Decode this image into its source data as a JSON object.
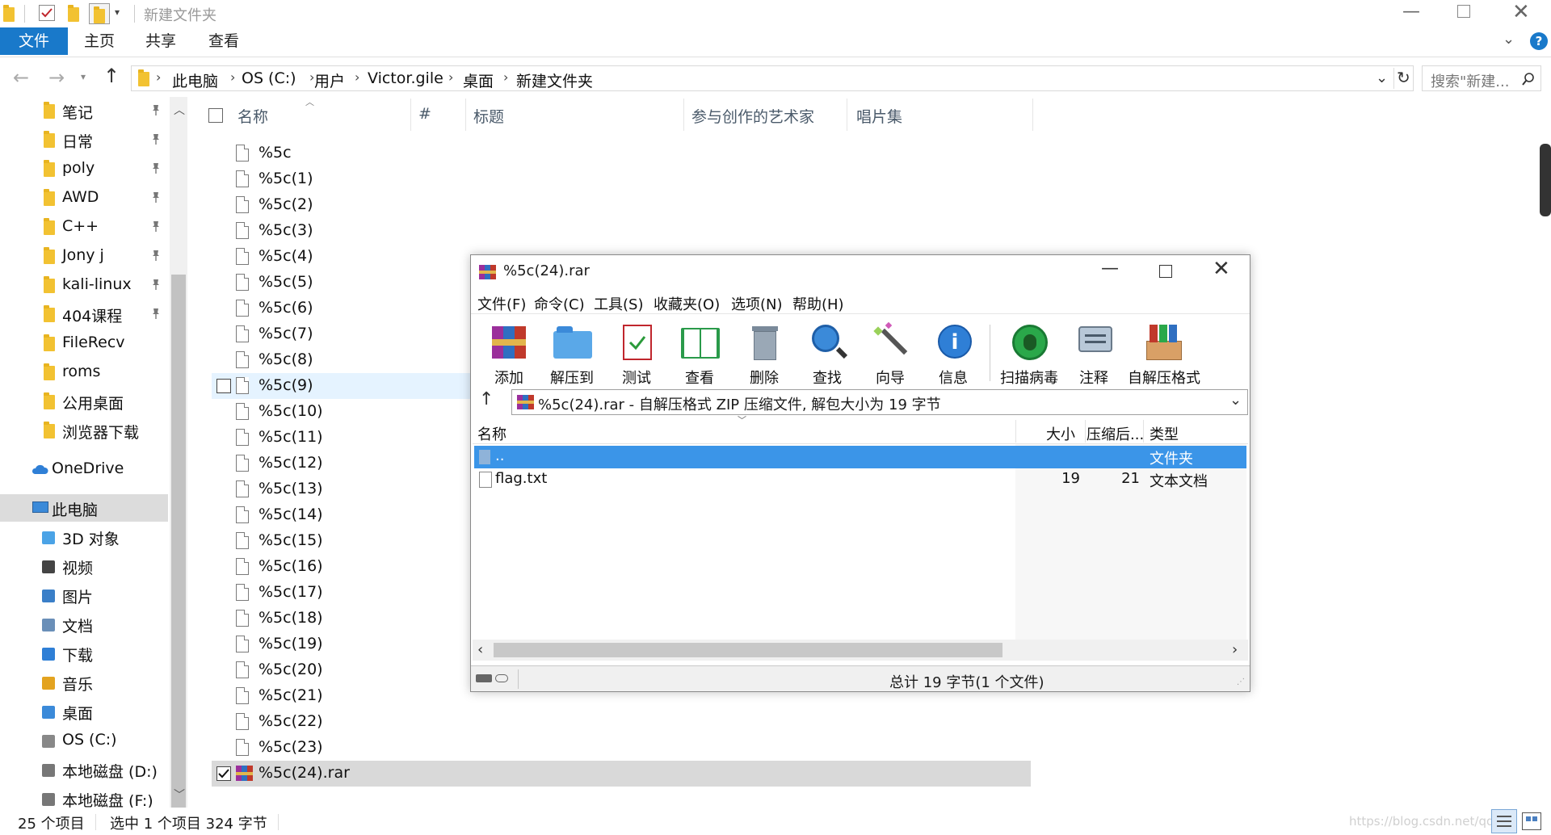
{
  "titlebar": {
    "title": "新建文件夹"
  },
  "ribbon": {
    "tabs": [
      "文件",
      "主页",
      "共享",
      "查看"
    ]
  },
  "address": {
    "crumbs": [
      "此电脑",
      "OS (C:)",
      "用户",
      "Victor.gile",
      "桌面",
      "新建文件夹"
    ],
    "search_placeholder": "搜索\"新建..."
  },
  "nav": {
    "quick_access": [
      {
        "label": "笔记",
        "pinned": true
      },
      {
        "label": "日常",
        "pinned": true
      },
      {
        "label": "poly",
        "pinned": true
      },
      {
        "label": "AWD",
        "pinned": true
      },
      {
        "label": "C++",
        "pinned": true
      },
      {
        "label": "Jony j",
        "pinned": true
      },
      {
        "label": "kali-linux",
        "pinned": true
      },
      {
        "label": "404课程",
        "pinned": true
      },
      {
        "label": "FileRecv",
        "pinned": false
      },
      {
        "label": "roms",
        "pinned": false
      },
      {
        "label": "公用桌面",
        "pinned": false
      },
      {
        "label": "浏览器下载",
        "pinned": false
      }
    ],
    "onedrive": "OneDrive",
    "this_pc": "此电脑",
    "pc_items": [
      "3D 对象",
      "视频",
      "图片",
      "文档",
      "下载",
      "音乐",
      "桌面",
      "OS (C:)",
      "本地磁盘 (D:)",
      "本地磁盘 (F:)"
    ]
  },
  "columns": {
    "name": "名称",
    "number": "#",
    "title": "标题",
    "artists": "参与创作的艺术家",
    "album": "唱片集"
  },
  "files": [
    "%5c",
    "%5c(1)",
    "%5c(2)",
    "%5c(3)",
    "%5c(4)",
    "%5c(5)",
    "%5c(6)",
    "%5c(7)",
    "%5c(8)",
    "%5c(9)",
    "%5c(10)",
    "%5c(11)",
    "%5c(12)",
    "%5c(13)",
    "%5c(14)",
    "%5c(15)",
    "%5c(16)",
    "%5c(17)",
    "%5c(18)",
    "%5c(19)",
    "%5c(20)",
    "%5c(21)",
    "%5c(22)",
    "%5c(23)",
    "%5c(24).rar"
  ],
  "status": {
    "count": "25 个项目",
    "selected": "选中 1 个项目  324 字节",
    "watermark": "https://blog.csdn.net/qq_"
  },
  "winrar": {
    "title": "%5c(24).rar",
    "menu": [
      "文件(F)",
      "命令(C)",
      "工具(S)",
      "收藏夹(O)",
      "选项(N)",
      "帮助(H)"
    ],
    "tools": [
      "添加",
      "解压到",
      "测试",
      "查看",
      "删除",
      "查找",
      "向导",
      "信息",
      "扫描病毒",
      "注释",
      "自解压格式"
    ],
    "path": "%5c(24).rar - 自解压格式 ZIP 压缩文件, 解包大小为 19 字节",
    "columns": {
      "name": "名称",
      "size": "大小",
      "packed": "压缩后...",
      "type": "类型"
    },
    "rows": [
      {
        "name": "..",
        "size": "",
        "packed": "",
        "type": "文件夹"
      },
      {
        "name": "flag.txt",
        "size": "19",
        "packed": "21",
        "type": "文本文档"
      }
    ],
    "status": "总计 19 字节(1 个文件)"
  }
}
